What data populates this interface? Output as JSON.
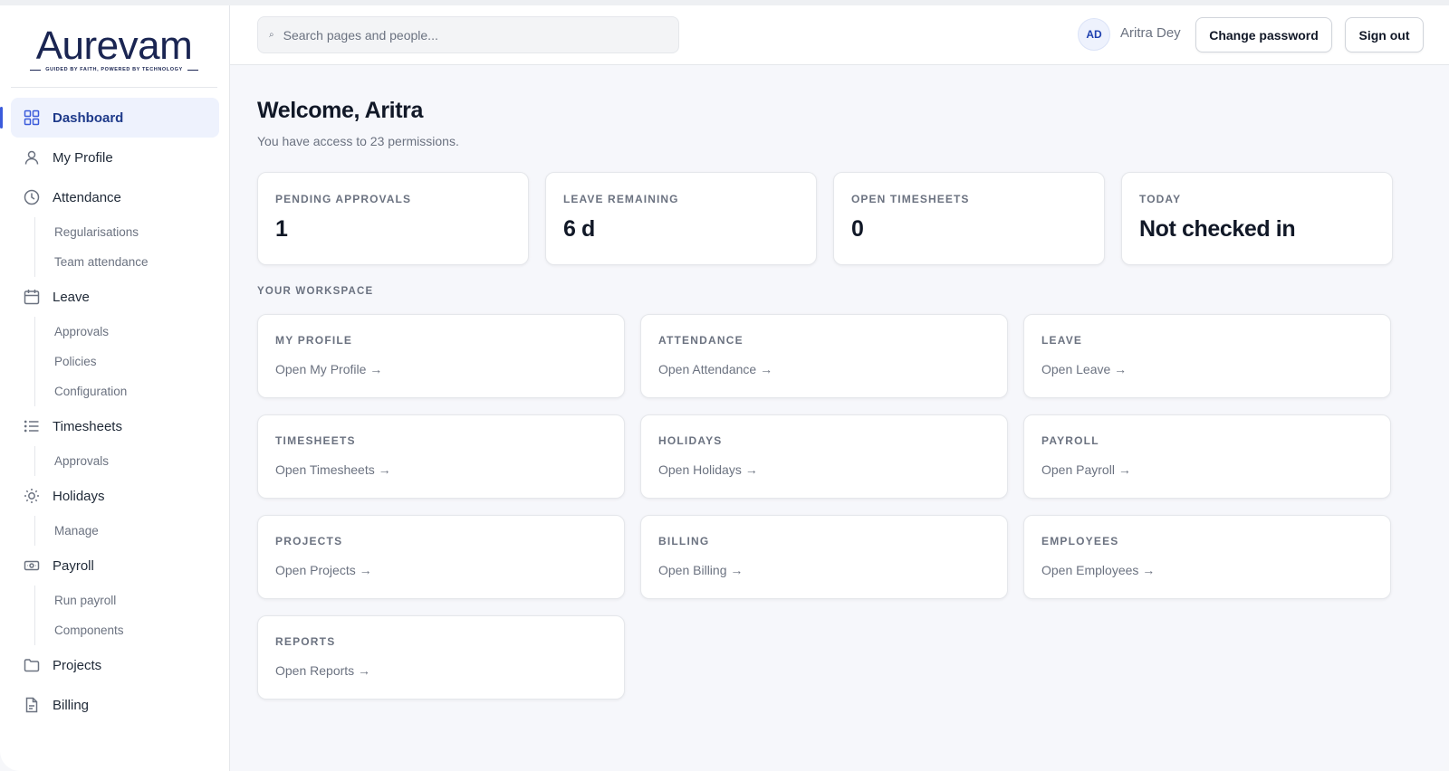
{
  "brand": {
    "name": "Aurevam",
    "tagline": "GUIDED BY FAITH, POWERED BY TECHNOLOGY",
    "color": "#1a2552"
  },
  "sidebar": {
    "items": [
      {
        "label": "Dashboard",
        "icon": "grid-icon",
        "active": true,
        "sub": []
      },
      {
        "label": "My Profile",
        "icon": "user-icon",
        "sub": []
      },
      {
        "label": "Attendance",
        "icon": "clock-icon",
        "sub": [
          "Regularisations",
          "Team attendance"
        ]
      },
      {
        "label": "Leave",
        "icon": "calendar-icon",
        "sub": [
          "Approvals",
          "Policies",
          "Configuration"
        ]
      },
      {
        "label": "Timesheets",
        "icon": "list-icon",
        "sub": [
          "Approvals"
        ]
      },
      {
        "label": "Holidays",
        "icon": "sun-icon",
        "sub": [
          "Manage"
        ]
      },
      {
        "label": "Payroll",
        "icon": "banknote-icon",
        "sub": [
          "Run payroll",
          "Components"
        ]
      },
      {
        "label": "Projects",
        "icon": "folder-icon",
        "sub": []
      },
      {
        "label": "Billing",
        "icon": "file-text-icon",
        "sub": []
      }
    ]
  },
  "header": {
    "search_placeholder": "Search pages and people...",
    "user_initials": "AD",
    "user_name": "Aritra Dey",
    "change_password": "Change password",
    "sign_out": "Sign out"
  },
  "main": {
    "welcome": "Welcome, Aritra",
    "subtitle": "You have access to 23 permissions.",
    "stats": [
      {
        "label": "PENDING APPROVALS",
        "value": "1"
      },
      {
        "label": "LEAVE REMAINING",
        "value": "6 d"
      },
      {
        "label": "OPEN TIMESHEETS",
        "value": "0"
      },
      {
        "label": "TODAY",
        "value": "Not checked in"
      }
    ],
    "workspace_label": "YOUR WORKSPACE",
    "cards": [
      {
        "title": "MY PROFILE",
        "link": "Open My Profile →"
      },
      {
        "title": "ATTENDANCE",
        "link": "Open Attendance →"
      },
      {
        "title": "LEAVE",
        "link": "Open Leave →"
      },
      {
        "title": "TIMESHEETS",
        "link": "Open Timesheets →"
      },
      {
        "title": "HOLIDAYS",
        "link": "Open Holidays →"
      },
      {
        "title": "PAYROLL",
        "link": "Open Payroll →"
      },
      {
        "title": "PROJECTS",
        "link": "Open Projects →"
      },
      {
        "title": "BILLING",
        "link": "Open Billing →"
      },
      {
        "title": "EMPLOYEES",
        "link": "Open Employees →"
      },
      {
        "title": "REPORTS",
        "link": "Open Reports →"
      }
    ]
  },
  "colors": {
    "accent": "#3b5bdb",
    "active_bg": "#eef2fd",
    "muted_text": "#6b7280"
  }
}
